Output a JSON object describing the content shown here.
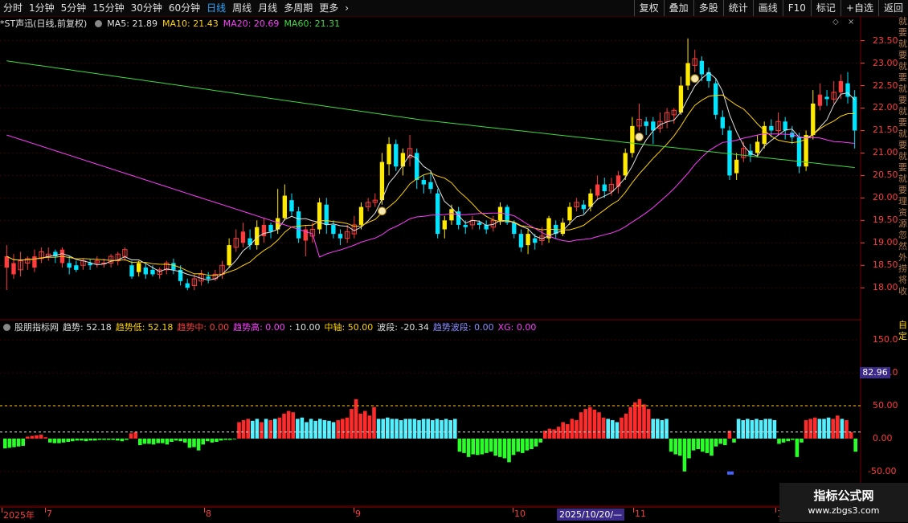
{
  "toolbar": {
    "periods": [
      "分时",
      "1分钟",
      "5分钟",
      "15分钟",
      "30分钟",
      "60分钟",
      "日线",
      "周线",
      "月线",
      "多周期",
      "更多"
    ],
    "active_index": 6,
    "more_chevron": "›",
    "right_buttons": [
      "复权",
      "叠加",
      "多股",
      "统计",
      "画线",
      "F10",
      "标记",
      "+自选",
      "返回"
    ]
  },
  "main_info": {
    "title": "*ST声迅(日线,前复权)",
    "ma5": "MA5: 21.89",
    "ma10": "MA10: 21.43",
    "ma20": "MA20: 20.69",
    "ma60": "MA60: 21.31",
    "colors": {
      "ma5": "#e0e0e0",
      "ma10": "#ffd200",
      "ma20": "#ff3cff",
      "ma60": "#3cdc3c"
    }
  },
  "top_icons": [
    "◇",
    "×"
  ],
  "indicator_info": {
    "name": "股朋指标网",
    "items": [
      {
        "text": "趋势: 52.18",
        "color": "#e0e0e0"
      },
      {
        "text": "趋势低: 52.18",
        "color": "#ffd200"
      },
      {
        "text": "趋势中: 0.00",
        "color": "#ff3c3c"
      },
      {
        "text": "趋势高: 0.00",
        "color": "#ff3cff"
      },
      {
        "text": ": 10.00",
        "color": "#e0e0e0"
      },
      {
        "text": "中轴: 50.00",
        "color": "#ffd200"
      },
      {
        "text": "波段: -20.34",
        "color": "#e0e0e0"
      },
      {
        "text": "趋势波段: 0.00",
        "color": "#8c8cff"
      },
      {
        "text": "XG: 0.00",
        "color": "#ff3cff"
      }
    ]
  },
  "price_axis": {
    "ticks": [
      "23.50",
      "23.00",
      "22.50",
      "22.00",
      "21.50",
      "21.00",
      "20.50",
      "20.00",
      "19.50",
      "19.00",
      "18.50",
      "18.00"
    ],
    "sub_ticks": [
      "150.0",
      "100.0",
      "50.00",
      "0.00",
      "-50.00"
    ],
    "readout": "82.96"
  },
  "right_strip_text": "就要就要就要就要就要就要就要就要理资源忽然外捞将收",
  "right_strip2_text": "自定",
  "date_axis": {
    "labels": [
      {
        "text": "2025年",
        "x": 4
      },
      {
        "text": "7",
        "x": 58
      },
      {
        "text": "8",
        "x": 256
      },
      {
        "text": "9",
        "x": 442
      },
      {
        "text": "10",
        "x": 640
      },
      {
        "text": "11",
        "x": 790
      },
      {
        "text": "12",
        "x": 967
      }
    ],
    "cursor": "2025/10/20/—"
  },
  "watermark": {
    "line1": "指标公式网",
    "line2": "www.zbgs3.com"
  },
  "chart_data": {
    "type": "candlestick",
    "symbol": "*ST声迅",
    "period": "日线",
    "ylim": [
      17.7,
      23.6
    ],
    "candles": [
      [
        18.45,
        18.7,
        18.95,
        17.95
      ],
      [
        18.3,
        18.55,
        18.75,
        18.2
      ],
      [
        18.4,
        18.6,
        18.8,
        18.25
      ],
      [
        18.55,
        18.65,
        18.7,
        18.4
      ],
      [
        18.45,
        18.7,
        18.85,
        18.35
      ],
      [
        18.65,
        18.8,
        18.9,
        18.55
      ],
      [
        18.7,
        18.75,
        18.9,
        18.6
      ],
      [
        18.8,
        18.7,
        18.85,
        18.55
      ],
      [
        18.55,
        18.85,
        18.9,
        18.45
      ],
      [
        18.55,
        18.45,
        18.7,
        18.3
      ],
      [
        18.5,
        18.4,
        18.6,
        18.35
      ],
      [
        18.5,
        18.6,
        18.65,
        18.4
      ],
      [
        18.55,
        18.5,
        18.65,
        18.4
      ],
      [
        18.55,
        18.6,
        18.7,
        18.45
      ],
      [
        18.55,
        18.55,
        18.65,
        18.45
      ],
      [
        18.55,
        18.7,
        18.75,
        18.45
      ],
      [
        18.6,
        18.75,
        18.8,
        18.5
      ],
      [
        18.7,
        18.85,
        18.9,
        18.6
      ],
      [
        18.5,
        18.25,
        18.6,
        18.2
      ],
      [
        18.35,
        18.55,
        18.6,
        18.25
      ],
      [
        18.45,
        18.3,
        18.55,
        18.2
      ],
      [
        18.4,
        18.3,
        18.5,
        18.25
      ],
      [
        18.3,
        18.4,
        18.45,
        18.2
      ],
      [
        18.4,
        18.55,
        18.6,
        18.3
      ],
      [
        18.55,
        18.4,
        18.65,
        18.3
      ],
      [
        18.4,
        18.15,
        18.5,
        18.05
      ],
      [
        18.1,
        18.0,
        18.2,
        17.95
      ],
      [
        18.05,
        18.2,
        18.3,
        17.95
      ],
      [
        18.15,
        18.3,
        18.4,
        18.05
      ],
      [
        18.25,
        18.2,
        18.35,
        18.1
      ],
      [
        18.2,
        18.3,
        18.4,
        18.15
      ],
      [
        18.3,
        18.5,
        18.6,
        18.2
      ],
      [
        18.5,
        18.95,
        19.1,
        18.45
      ],
      [
        18.9,
        19.1,
        19.3,
        18.8
      ],
      [
        19.0,
        19.25,
        19.45,
        18.9
      ],
      [
        19.1,
        18.95,
        19.3,
        18.85
      ],
      [
        18.95,
        19.35,
        19.5,
        18.85
      ],
      [
        19.15,
        19.4,
        19.55,
        19.0
      ],
      [
        19.4,
        19.25,
        19.45,
        19.1
      ],
      [
        19.3,
        19.55,
        20.2,
        19.2
      ],
      [
        19.55,
        20.05,
        20.3,
        19.5
      ],
      [
        19.95,
        19.7,
        20.1,
        19.6
      ],
      [
        19.7,
        19.1,
        19.8,
        19.0
      ],
      [
        19.05,
        19.3,
        19.4,
        18.7
      ],
      [
        19.15,
        19.3,
        19.45,
        19.0
      ],
      [
        19.3,
        19.9,
        20.0,
        19.2
      ],
      [
        19.85,
        19.4,
        20.0,
        19.2
      ],
      [
        19.4,
        19.2,
        19.5,
        19.1
      ],
      [
        19.2,
        19.1,
        19.3,
        18.95
      ],
      [
        19.1,
        19.25,
        19.4,
        19.0
      ],
      [
        19.2,
        19.4,
        19.6,
        19.1
      ],
      [
        19.4,
        19.8,
        19.9,
        19.3
      ],
      [
        19.8,
        19.9,
        20.0,
        19.7
      ],
      [
        19.9,
        19.95,
        20.1,
        19.8
      ],
      [
        19.95,
        20.8,
        21.0,
        19.85
      ],
      [
        20.75,
        21.2,
        21.35,
        20.5
      ],
      [
        21.2,
        20.7,
        21.3,
        20.6
      ],
      [
        20.7,
        21.0,
        21.1,
        20.5
      ],
      [
        20.9,
        21.1,
        21.4,
        20.7
      ],
      [
        21.0,
        20.4,
        21.1,
        20.2
      ],
      [
        20.4,
        20.3,
        20.5,
        20.1
      ],
      [
        20.35,
        20.2,
        20.6,
        20.1
      ],
      [
        20.1,
        19.2,
        20.2,
        19.1
      ],
      [
        19.3,
        19.5,
        19.6,
        19.1
      ],
      [
        19.5,
        19.75,
        19.85,
        19.4
      ],
      [
        19.7,
        19.4,
        19.8,
        19.3
      ],
      [
        19.4,
        19.35,
        19.5,
        19.2
      ],
      [
        19.4,
        19.5,
        19.6,
        19.3
      ],
      [
        19.45,
        19.4,
        19.5,
        19.3
      ],
      [
        19.4,
        19.3,
        19.5,
        19.2
      ],
      [
        19.35,
        19.5,
        19.6,
        19.25
      ],
      [
        19.5,
        19.8,
        19.9,
        19.4
      ],
      [
        19.8,
        19.45,
        19.85,
        19.4
      ],
      [
        19.45,
        19.2,
        19.5,
        19.1
      ],
      [
        19.2,
        18.9,
        19.3,
        18.8
      ],
      [
        18.95,
        19.2,
        19.3,
        18.75
      ],
      [
        19.1,
        19.0,
        19.2,
        18.85
      ],
      [
        19.05,
        19.15,
        19.35,
        18.95
      ],
      [
        19.1,
        19.55,
        19.6,
        19.0
      ],
      [
        19.4,
        19.2,
        19.5,
        19.1
      ],
      [
        19.2,
        19.45,
        19.55,
        19.15
      ],
      [
        19.5,
        19.8,
        19.9,
        19.4
      ],
      [
        19.8,
        19.9,
        20.0,
        19.7
      ],
      [
        19.85,
        19.75,
        19.95,
        19.65
      ],
      [
        19.8,
        20.1,
        20.2,
        19.7
      ],
      [
        20.05,
        20.3,
        20.5,
        19.95
      ],
      [
        20.3,
        20.15,
        20.45,
        20.0
      ],
      [
        20.15,
        20.3,
        20.45,
        20.05
      ],
      [
        20.25,
        20.5,
        20.6,
        20.1
      ],
      [
        20.5,
        21.0,
        21.1,
        20.4
      ],
      [
        21.0,
        21.6,
        21.8,
        20.9
      ],
      [
        21.6,
        21.75,
        22.1,
        21.5
      ],
      [
        21.7,
        21.6,
        21.8,
        21.4
      ],
      [
        21.7,
        21.5,
        21.8,
        21.2
      ],
      [
        21.55,
        21.7,
        21.9,
        21.45
      ],
      [
        21.7,
        21.9,
        22.0,
        21.55
      ],
      [
        21.85,
        21.95,
        22.0,
        21.65
      ],
      [
        21.9,
        22.5,
        22.7,
        21.85
      ],
      [
        22.5,
        23.0,
        23.55,
        22.4
      ],
      [
        22.95,
        23.1,
        23.3,
        22.8
      ],
      [
        23.05,
        22.75,
        23.15,
        22.6
      ],
      [
        22.8,
        22.6,
        22.9,
        22.45
      ],
      [
        22.55,
        21.85,
        22.65,
        21.75
      ],
      [
        21.8,
        21.55,
        21.95,
        21.4
      ],
      [
        21.5,
        20.5,
        21.6,
        20.4
      ],
      [
        20.55,
        20.85,
        21.0,
        20.4
      ],
      [
        20.9,
        21.1,
        21.25,
        20.8
      ],
      [
        21.05,
        20.95,
        21.2,
        20.8
      ],
      [
        21.0,
        21.25,
        21.4,
        20.9
      ],
      [
        21.2,
        21.6,
        21.7,
        21.1
      ],
      [
        21.6,
        21.5,
        21.75,
        21.35
      ],
      [
        21.5,
        21.7,
        21.9,
        21.4
      ],
      [
        21.7,
        21.5,
        21.8,
        21.3
      ],
      [
        21.45,
        21.35,
        21.6,
        21.2
      ],
      [
        21.35,
        20.7,
        21.45,
        20.55
      ],
      [
        20.7,
        21.4,
        21.5,
        20.6
      ],
      [
        21.4,
        22.1,
        22.4,
        21.3
      ],
      [
        22.05,
        22.3,
        22.55,
        21.95
      ],
      [
        22.25,
        22.2,
        22.4,
        22.05
      ],
      [
        22.2,
        22.35,
        22.6,
        22.1
      ],
      [
        22.35,
        22.6,
        22.75,
        22.2
      ],
      [
        22.55,
        22.25,
        22.8,
        22.1
      ],
      [
        22.25,
        21.5,
        22.4,
        21.1
      ]
    ]
  },
  "sub_chart_data": {
    "type": "bar",
    "ylim": [
      -60,
      160
    ],
    "ref_lines": [
      50,
      10
    ],
    "values": [
      [
        -15,
        "g"
      ],
      [
        -14,
        "g"
      ],
      [
        -13,
        "g"
      ],
      [
        -12,
        "g"
      ],
      [
        -11,
        "g"
      ],
      [
        3,
        "r"
      ],
      [
        4,
        "r"
      ],
      [
        5,
        "r"
      ],
      [
        6,
        "r"
      ],
      [
        2,
        "r"
      ],
      [
        -6,
        "g"
      ],
      [
        -7,
        "g"
      ],
      [
        -7,
        "g"
      ],
      [
        -6,
        "g"
      ],
      [
        -5,
        "g"
      ],
      [
        -4,
        "g"
      ],
      [
        -3,
        "g"
      ],
      [
        -3,
        "g"
      ],
      [
        -4,
        "g"
      ],
      [
        -3,
        "g"
      ],
      [
        -3,
        "g"
      ],
      [
        -2,
        "g"
      ],
      [
        -2,
        "g"
      ],
      [
        -2,
        "g"
      ],
      [
        -2,
        "g"
      ],
      [
        -3,
        "g"
      ],
      [
        -4,
        "g"
      ],
      [
        -2,
        "g"
      ],
      [
        8,
        "r"
      ],
      [
        10,
        "r"
      ],
      [
        -10,
        "g"
      ],
      [
        -8,
        "g"
      ],
      [
        -8,
        "g"
      ],
      [
        -9,
        "g"
      ],
      [
        -7,
        "g"
      ],
      [
        -7,
        "g"
      ],
      [
        -9,
        "g"
      ],
      [
        -5,
        "g"
      ],
      [
        -3,
        "g"
      ],
      [
        -4,
        "g"
      ],
      [
        -6,
        "g"
      ],
      [
        -14,
        "g"
      ],
      [
        -13,
        "g"
      ],
      [
        -18,
        "g"
      ],
      [
        -9,
        "g"
      ],
      [
        -4,
        "g"
      ],
      [
        -6,
        "g"
      ],
      [
        -5,
        "g"
      ],
      [
        -3,
        "g"
      ],
      [
        -2,
        "g"
      ],
      [
        -2,
        "g"
      ],
      [
        -1,
        "g"
      ],
      [
        25,
        "r"
      ],
      [
        28,
        "r"
      ],
      [
        30,
        "r"
      ],
      [
        27,
        "c"
      ],
      [
        30,
        "c"
      ],
      [
        25,
        "r"
      ],
      [
        30,
        "c"
      ],
      [
        28,
        "r"
      ],
      [
        30,
        "c"
      ],
      [
        32,
        "r"
      ],
      [
        38,
        "r"
      ],
      [
        42,
        "r"
      ],
      [
        40,
        "r"
      ],
      [
        30,
        "c"
      ],
      [
        32,
        "c"
      ],
      [
        25,
        "c"
      ],
      [
        30,
        "c"
      ],
      [
        27,
        "c"
      ],
      [
        30,
        "c"
      ],
      [
        28,
        "c"
      ],
      [
        27,
        "c"
      ],
      [
        25,
        "c"
      ],
      [
        28,
        "r"
      ],
      [
        30,
        "r"
      ],
      [
        32,
        "r"
      ],
      [
        45,
        "r"
      ],
      [
        60,
        "r"
      ],
      [
        38,
        "r"
      ],
      [
        42,
        "r"
      ],
      [
        35,
        "r"
      ],
      [
        48,
        "r"
      ],
      [
        30,
        "c"
      ],
      [
        30,
        "c"
      ],
      [
        32,
        "c"
      ],
      [
        30,
        "c"
      ],
      [
        30,
        "c"
      ],
      [
        28,
        "c"
      ],
      [
        30,
        "c"
      ],
      [
        30,
        "c"
      ],
      [
        30,
        "c"
      ],
      [
        28,
        "c"
      ],
      [
        30,
        "c"
      ],
      [
        30,
        "c"
      ],
      [
        28,
        "c"
      ],
      [
        30,
        "c"
      ],
      [
        28,
        "c"
      ],
      [
        30,
        "c"
      ],
      [
        28,
        "c"
      ],
      [
        30,
        "c"
      ],
      [
        -20,
        "g"
      ],
      [
        -22,
        "g"
      ],
      [
        -28,
        "g"
      ],
      [
        -24,
        "g"
      ],
      [
        -25,
        "g"
      ],
      [
        -24,
        "g"
      ],
      [
        -22,
        "g"
      ],
      [
        -20,
        "g"
      ],
      [
        -26,
        "g"
      ],
      [
        -28,
        "g"
      ],
      [
        -30,
        "g"
      ],
      [
        -36,
        "g"
      ],
      [
        -25,
        "g"
      ],
      [
        -20,
        "g"
      ],
      [
        -22,
        "g"
      ],
      [
        -18,
        "g"
      ],
      [
        -16,
        "g"
      ],
      [
        -12,
        "g"
      ],
      [
        -6,
        "g"
      ],
      [
        12,
        "r"
      ],
      [
        15,
        "r"
      ],
      [
        14,
        "r"
      ],
      [
        18,
        "r"
      ],
      [
        25,
        "r"
      ],
      [
        22,
        "r"
      ],
      [
        30,
        "r"
      ],
      [
        28,
        "r"
      ],
      [
        40,
        "r"
      ],
      [
        45,
        "r"
      ],
      [
        48,
        "r"
      ],
      [
        44,
        "r"
      ],
      [
        40,
        "r"
      ],
      [
        32,
        "r"
      ],
      [
        30,
        "c"
      ],
      [
        28,
        "c"
      ],
      [
        25,
        "c"
      ],
      [
        32,
        "r"
      ],
      [
        38,
        "r"
      ],
      [
        48,
        "r"
      ],
      [
        55,
        "r"
      ],
      [
        60,
        "r"
      ],
      [
        52,
        "r"
      ],
      [
        45,
        "r"
      ],
      [
        30,
        "c"
      ],
      [
        30,
        "c"
      ],
      [
        28,
        "c"
      ],
      [
        30,
        "c"
      ],
      [
        -20,
        "g"
      ],
      [
        -24,
        "g"
      ],
      [
        -26,
        "g"
      ],
      [
        -50,
        "g"
      ],
      [
        -30,
        "g"
      ],
      [
        -18,
        "g"
      ],
      [
        -16,
        "g"
      ],
      [
        -20,
        "g"
      ],
      [
        -22,
        "g"
      ],
      [
        -26,
        "g"
      ],
      [
        -12,
        "g"
      ],
      [
        -8,
        "g"
      ],
      [
        -10,
        "g"
      ],
      [
        12,
        "r"
      ],
      [
        -6,
        "g"
      ],
      [
        30,
        "c"
      ],
      [
        28,
        "c"
      ],
      [
        30,
        "c"
      ],
      [
        28,
        "c"
      ],
      [
        30,
        "c"
      ],
      [
        28,
        "c"
      ],
      [
        30,
        "c"
      ],
      [
        30,
        "c"
      ],
      [
        28,
        "c"
      ],
      [
        -8,
        "g"
      ],
      [
        -6,
        "g"
      ],
      [
        -4,
        "g"
      ],
      [
        -2,
        "g"
      ],
      [
        -28,
        "g"
      ],
      [
        -6,
        "g"
      ],
      [
        28,
        "r"
      ],
      [
        30,
        "r"
      ],
      [
        32,
        "r"
      ],
      [
        30,
        "c"
      ],
      [
        30,
        "c"
      ],
      [
        32,
        "c"
      ],
      [
        30,
        "r"
      ],
      [
        35,
        "r"
      ],
      [
        30,
        "c"
      ],
      [
        28,
        "r"
      ],
      [
        10,
        "r"
      ],
      [
        -20,
        "g"
      ]
    ]
  }
}
